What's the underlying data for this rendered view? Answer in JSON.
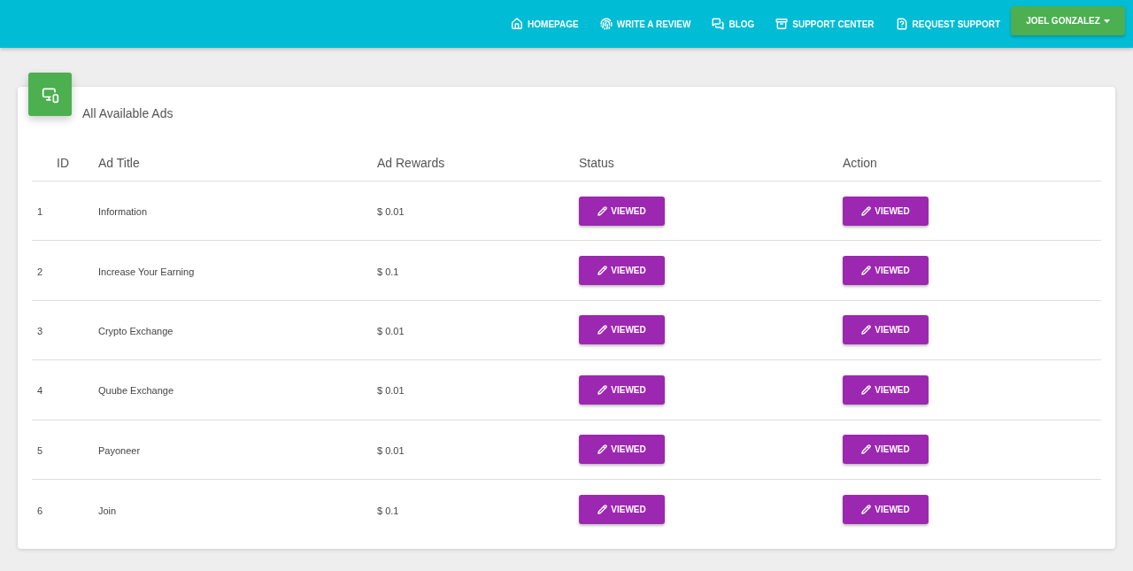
{
  "nav": {
    "items": [
      {
        "label": "HOMEPAGE"
      },
      {
        "label": "WRITE A REVIEW"
      },
      {
        "label": "BLOG"
      },
      {
        "label": "SUPPORT CENTER"
      },
      {
        "label": "REQUEST SUPPORT"
      }
    ],
    "user": "JOEL GONZALEZ"
  },
  "card": {
    "title": "All Available Ads"
  },
  "table": {
    "columns": [
      "ID",
      "Ad Title",
      "Ad Rewards",
      "Status",
      "Action"
    ],
    "rows": [
      {
        "id": "1",
        "title": "Information",
        "reward": "$ 0.01",
        "status": "VIEWED",
        "action": "VIEWED"
      },
      {
        "id": "2",
        "title": "Increase Your Earning",
        "reward": "$ 0.1",
        "status": "VIEWED",
        "action": "VIEWED"
      },
      {
        "id": "3",
        "title": "Crypto Exchange",
        "reward": "$ 0.01",
        "status": "VIEWED",
        "action": "VIEWED"
      },
      {
        "id": "4",
        "title": "Quube Exchange",
        "reward": "$ 0.01",
        "status": "VIEWED",
        "action": "VIEWED"
      },
      {
        "id": "5",
        "title": "Payoneer",
        "reward": "$ 0.01",
        "status": "VIEWED",
        "action": "VIEWED"
      },
      {
        "id": "6",
        "title": "Join",
        "reward": "$ 0.1",
        "status": "VIEWED",
        "action": "VIEWED"
      }
    ]
  }
}
